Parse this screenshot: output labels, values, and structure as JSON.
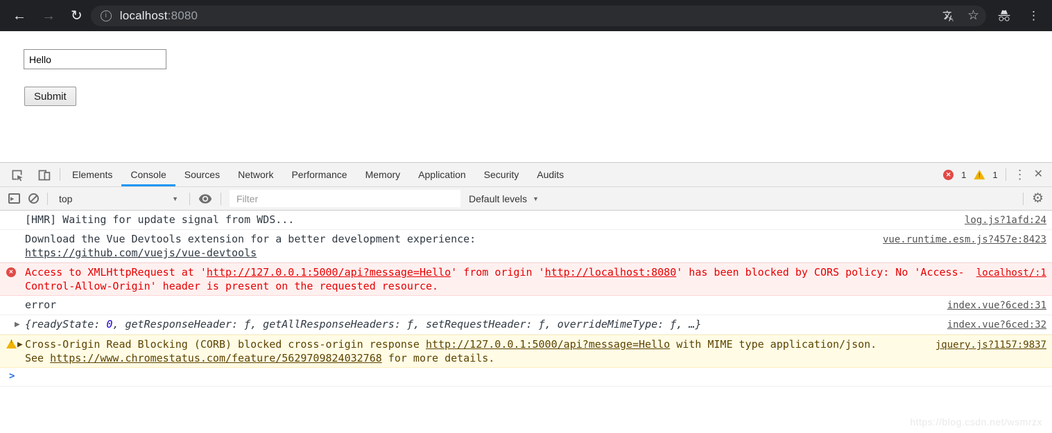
{
  "colors": {
    "accent_blue": "#2196f3",
    "error_red": "#e04a47",
    "error_text": "#e60000",
    "warning_yellow": "#f1b400",
    "warning_text": "#5c4400",
    "toolbar_dark": "#1f2124"
  },
  "icons": {
    "back": "←",
    "forward": "→",
    "reload": "↻",
    "info": "i",
    "star": "☆",
    "kebab": "⋮",
    "close": "✕",
    "gear": "⚙",
    "caret": "▼",
    "expand": "▶",
    "prompt": ">"
  },
  "browser": {
    "url_host": "localhost",
    "url_port": ":8080"
  },
  "page": {
    "input_value": "Hello",
    "submit_label": "Submit"
  },
  "devtools": {
    "tabs": [
      "Elements",
      "Console",
      "Sources",
      "Network",
      "Performance",
      "Memory",
      "Application",
      "Security",
      "Audits"
    ],
    "active_tab": "Console",
    "error_count": "1",
    "warning_count": "1",
    "console_toolbar": {
      "context": "top",
      "filter_placeholder": "Filter",
      "levels_label": "Default levels"
    },
    "rows": {
      "hmr": {
        "text": "[HMR] Waiting for update signal from WDS...",
        "source": "log.js?1afd:24"
      },
      "vue": {
        "text": "Download the Vue Devtools extension for a better development experience:",
        "link": "https://github.com/vuejs/vue-devtools",
        "source": "vue.runtime.esm.js?457e:8423"
      },
      "cors_error": {
        "t1": "Access to XMLHttpRequest at '",
        "l1": "http://127.0.0.1:5000/api?message=Hello",
        "t2": "' from origin '",
        "l2": "http://localhost:8080",
        "t3": "' has been blocked by CORS policy: No 'Access-Control-Allow-Origin' header is present on the requested resource.",
        "source": "localhost/:1"
      },
      "error_text": {
        "text": "error",
        "source": "index.vue?6ced:31"
      },
      "xhr_object": {
        "p1": "{readyState: ",
        "v0": "0",
        "p2": ", getResponseHeader: ",
        "f": "ƒ",
        "p3": ", getAllResponseHeaders: ",
        "p4": ", setRequestHeader: ",
        "p5": ", overrideMimeType: ",
        "p6": ", …}",
        "source": "index.vue?6ced:32"
      },
      "corb_warning": {
        "t1": "Cross-Origin Read Blocking (CORB) blocked cross-origin response ",
        "l1": "http://127.0.0.1:5000/api?message=Hello",
        "t2": " with MIME type application/json. ",
        "t3": "See ",
        "l2": "https://www.chromestatus.com/feature/5629709824032768",
        "t4": " for more details.",
        "source": "jquery.js?1157:9837"
      }
    }
  },
  "watermark": "https://blog.csdn.net/wsmrzx"
}
